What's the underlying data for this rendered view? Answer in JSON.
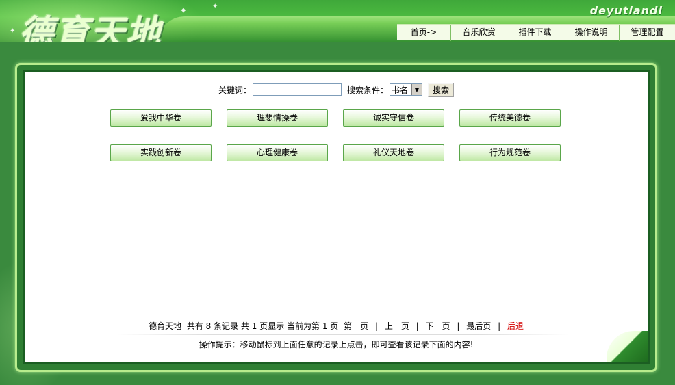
{
  "header": {
    "logo_text": "德育天地",
    "brand_en": "deyutiandi",
    "nav": [
      {
        "label": "首页->"
      },
      {
        "label": "音乐欣赏"
      },
      {
        "label": "插件下载"
      },
      {
        "label": "操作说明"
      },
      {
        "label": "管理配置"
      }
    ]
  },
  "search": {
    "keyword_label": "关键词：",
    "keyword_value": "",
    "condition_label": "搜索条件：",
    "condition_selected": "书名",
    "button_label": "搜索"
  },
  "categories": [
    {
      "label": "爱我中华卷"
    },
    {
      "label": "理想情操卷"
    },
    {
      "label": "诚实守信卷"
    },
    {
      "label": "传统美德卷"
    },
    {
      "label": "实践创新卷"
    },
    {
      "label": "心理健康卷"
    },
    {
      "label": "礼仪天地卷"
    },
    {
      "label": "行为规范卷"
    }
  ],
  "pager": {
    "site": "德育天地",
    "summary": "共有 8 条记录 共 1 页显示 当前为第 1 页",
    "first": "第一页",
    "prev": "上一页",
    "next": "下一页",
    "last": "最后页",
    "back": "后退",
    "separator": "|"
  },
  "tip": "操作提示：移动鼠标到上面任意的记录上点击，即可查看该记录下面的内容!",
  "colors": {
    "header_green": "#4cba40",
    "frame_green": "#2f7f33",
    "back_link": "#d40000"
  }
}
